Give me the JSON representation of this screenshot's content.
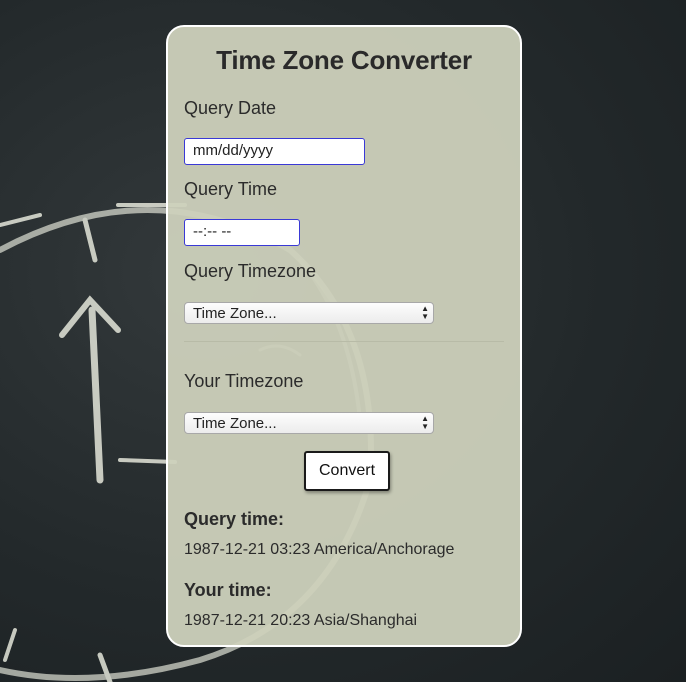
{
  "app": {
    "title": "Time Zone Converter"
  },
  "query_date": {
    "label": "Query Date",
    "placeholder": "mm/dd/yyyy"
  },
  "query_time": {
    "label": "Query Time",
    "placeholder": "--:-- --"
  },
  "query_timezone": {
    "label": "Query Timezone",
    "selected": "Time Zone..."
  },
  "your_timezone": {
    "label": "Your Timezone",
    "selected": "Time Zone..."
  },
  "convert_button": {
    "label": "Convert"
  },
  "results": {
    "query_heading": "Query time:",
    "query_value": "1987-12-21 03:23 America/Anchorage",
    "your_heading": "Your time:",
    "your_value": "1987-12-21 20:23 Asia/Shanghai"
  },
  "colors": {
    "card_background": "#cdd1bc",
    "input_border": "#3a39d6",
    "page_background": "#262c2e"
  }
}
